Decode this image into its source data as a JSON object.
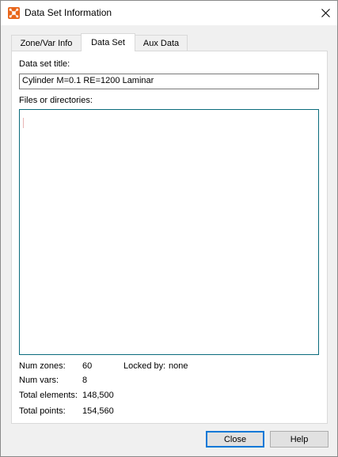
{
  "window": {
    "title": "Data Set Information",
    "app_icon": "tecplot-app-icon",
    "close_icon": "close-icon"
  },
  "tabs": [
    {
      "label": "Zone/Var Info",
      "active": false
    },
    {
      "label": "Data Set",
      "active": true
    },
    {
      "label": "Aux Data",
      "active": false
    }
  ],
  "dataset": {
    "title_label": "Data set title:",
    "title_value": "Cylinder M=0.1  RE=1200 Laminar",
    "files_label": "Files or directories:"
  },
  "info": {
    "num_zones_label": "Num zones:",
    "num_zones_value": "60",
    "locked_by_label": "Locked by:",
    "locked_by_value": "none",
    "num_vars_label": "Num vars:",
    "num_vars_value": "8",
    "total_elements_label": "Total elements:",
    "total_elements_value": "148,500",
    "total_points_label": "Total points:",
    "total_points_value": "154,560"
  },
  "buttons": {
    "close_label": "Close",
    "help_label": "Help"
  },
  "colors": {
    "accent": "#0078d7",
    "files_border": "#0a6b7c",
    "icon_orange": "#e8661b"
  }
}
